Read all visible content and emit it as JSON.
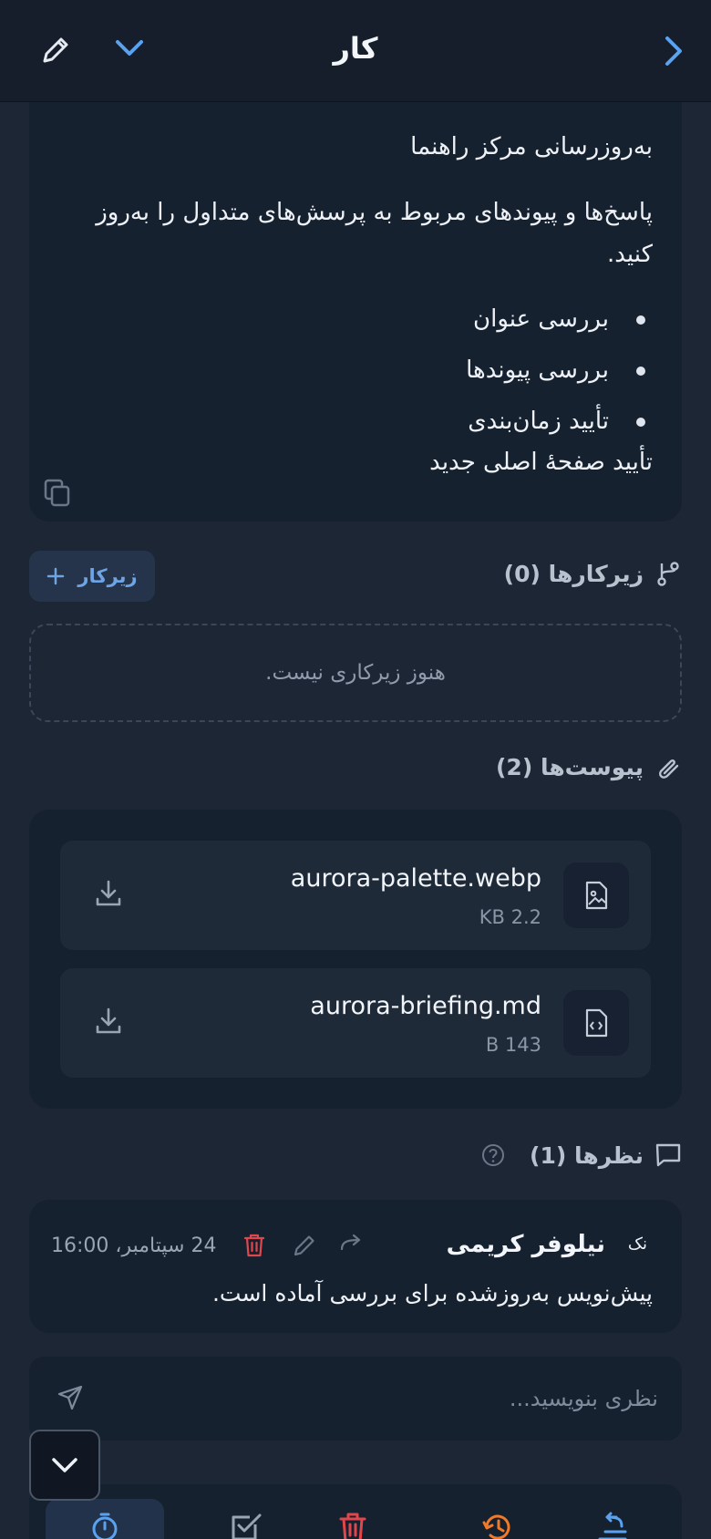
{
  "header": {
    "title": "کار"
  },
  "description": {
    "heading": "به‌روزرسانی مرکز راهنما",
    "paragraph": "پاسخ‌ها و پیوندهای مربوط به پرسش‌های متداول را به‌روز کنید.",
    "bullets": [
      "بررسی عنوان",
      "بررسی پیوندها",
      "تأیید زمان‌بندی"
    ],
    "confirm": "تأیید صفحهٔ اصلی جدید"
  },
  "subtasks": {
    "title": "زیرکارها (0)",
    "add_label": "زیرکار",
    "empty_text": "هنوز زیرکاری نیست."
  },
  "attachments": {
    "title": "پیوست‌ها (2)",
    "files": [
      {
        "name": "aurora-palette.webp",
        "size": "KB 2.2",
        "icon": "image-file-icon"
      },
      {
        "name": "aurora-briefing.md",
        "size": "B 143",
        "icon": "code-file-icon"
      }
    ]
  },
  "comments": {
    "title": "نظرها (1)",
    "items": [
      {
        "avatar": "نک",
        "author": "نیلوفر کریمی",
        "date": "24 سپتامبر، 16:00",
        "text": "پیش‌نویس به‌روزشده برای بررسی آماده است."
      }
    ],
    "input_placeholder": "نظری بنویسید..."
  },
  "colors": {
    "background": "#1c2634",
    "card": "#162130",
    "accent": "#5aa2f0",
    "danger": "#e0474c",
    "warning": "#f07a2a"
  }
}
